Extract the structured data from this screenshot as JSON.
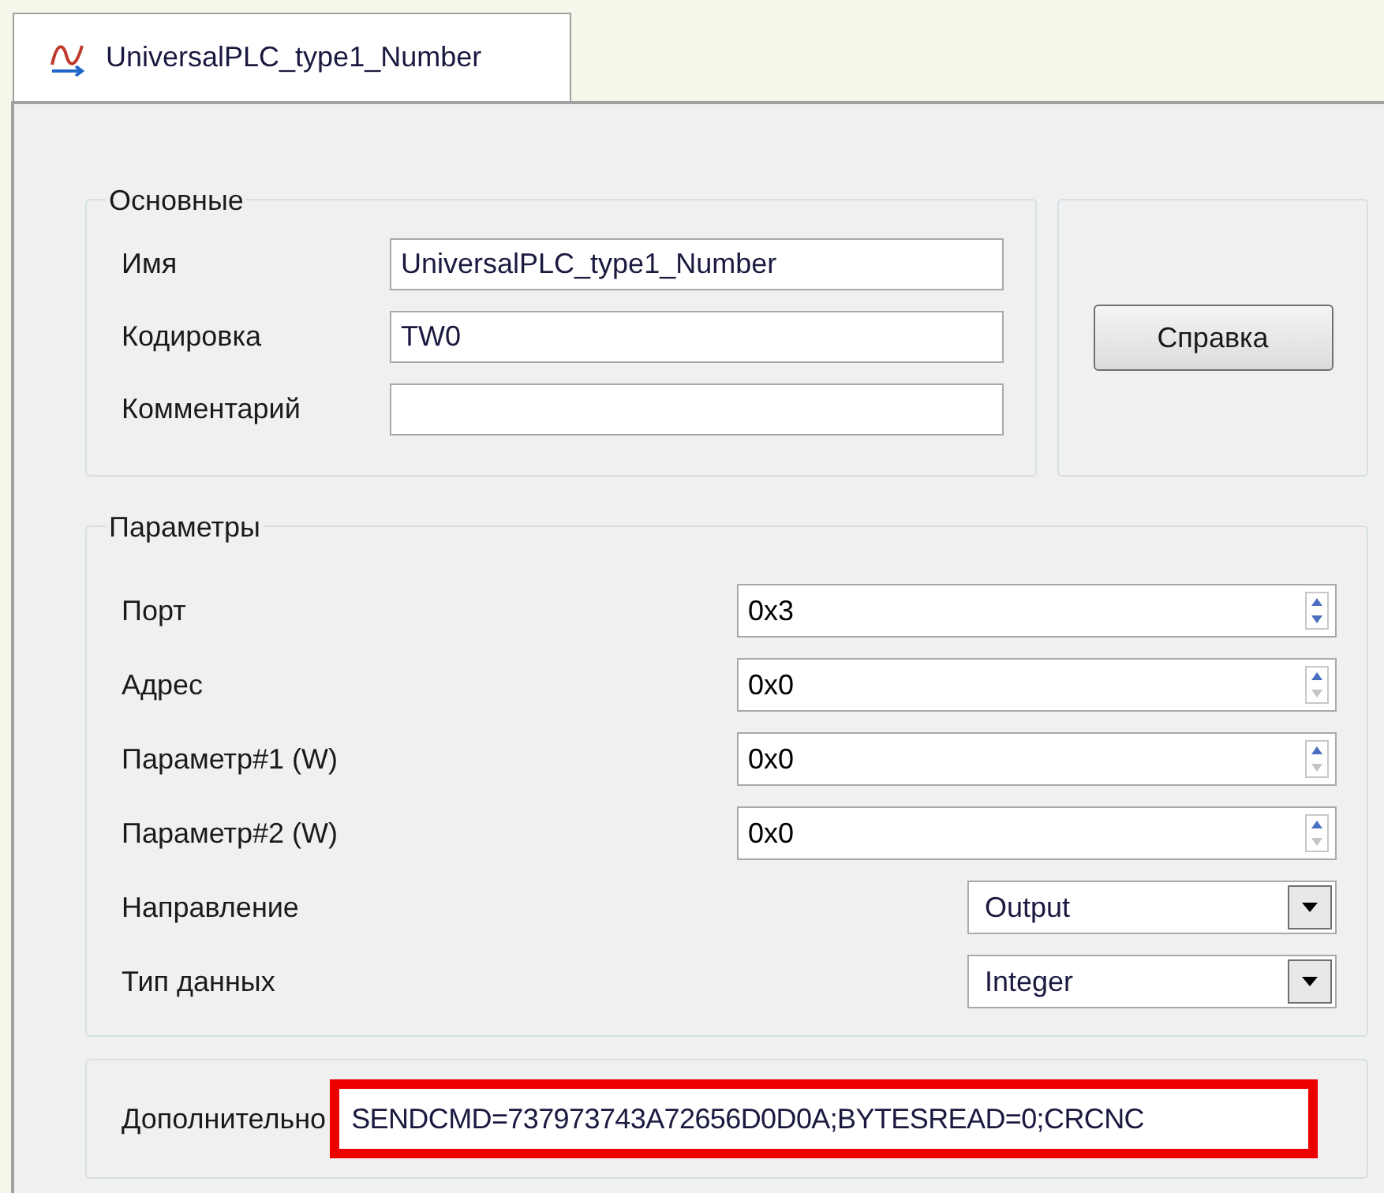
{
  "tab": {
    "label": "UniversalPLC_type1_Number",
    "selected": true
  },
  "main_group": {
    "title": "Основные",
    "fields": [
      {
        "label": "Имя",
        "value": "UniversalPLC_type1_Number"
      },
      {
        "label": "Кодировка",
        "value": "TW0"
      },
      {
        "label": "Комментарий"
      }
    ]
  },
  "help_button": "Справка",
  "params_group": {
    "title": "Параметры",
    "fields": [
      {
        "label": "Порт",
        "kind": "spinner",
        "value": "0x3",
        "down_disabled": false
      },
      {
        "label": "Адрес",
        "kind": "spinner",
        "value": "0x0",
        "down_disabled": true
      },
      {
        "label": "Параметр#1 (W)",
        "kind": "spinner",
        "value": "0x0",
        "down_disabled": true
      },
      {
        "label": "Параметр#2 (W)",
        "kind": "spinner",
        "value": "0x0",
        "down_disabled": true
      },
      {
        "label": "Направление",
        "kind": "dropdown",
        "value": "Output"
      },
      {
        "label": "Тип данных",
        "kind": "dropdown",
        "value": "Integer"
      }
    ]
  },
  "extra": {
    "label": "Дополнительно",
    "value": "SENDCMD=737973743A72656D0D0A;BYTESREAD=0;CRCNC",
    "highlighted": true
  }
}
